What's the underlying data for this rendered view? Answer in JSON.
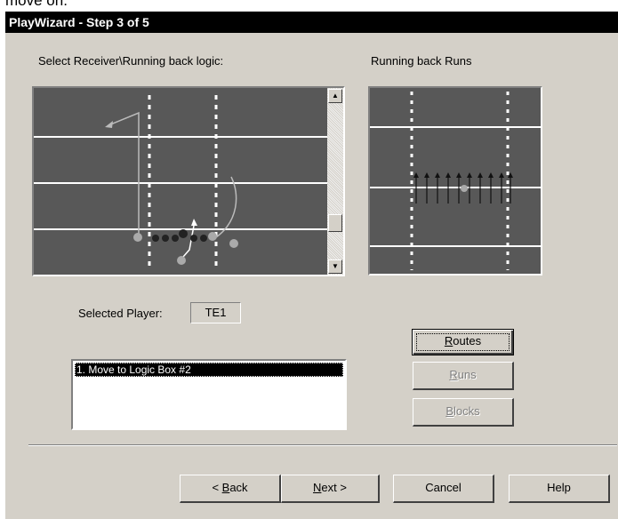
{
  "top_fragment": "move on.",
  "window": {
    "title": "PlayWizard - Step 3 of 5"
  },
  "logic_label": "Select Receiver\\Running back logic:",
  "preview_label": "Running back  Runs",
  "selected_player": {
    "label": "Selected Player:",
    "value": "TE1"
  },
  "logic_list": {
    "items": [
      "1. Move to Logic Box #2"
    ]
  },
  "side_buttons": {
    "routes": {
      "mnemonic": "R",
      "rest": "outes"
    },
    "runs": {
      "mnemonic": "R",
      "rest": "uns"
    },
    "blocks": {
      "mnemonic": "B",
      "rest": "locks"
    }
  },
  "nav_buttons": {
    "back": {
      "prefix": "< ",
      "mnemonic": "B",
      "rest": "ack"
    },
    "next": {
      "mnemonic": "N",
      "rest": "ext >"
    },
    "cancel": "Cancel",
    "help": "Help"
  },
  "colors": {
    "field": "#585858",
    "line": "#ffffff",
    "dialog": "#d4d0c8",
    "title_bg": "#000000"
  }
}
